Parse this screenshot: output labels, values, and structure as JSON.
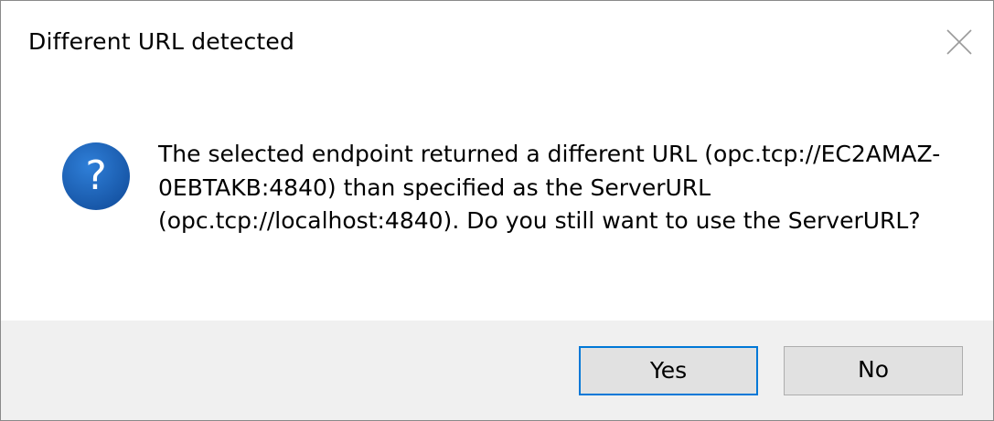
{
  "dialog": {
    "title": "Different URL detected",
    "message": "The selected endpoint returned a different URL (opc.tcp://EC2AMAZ-0EBTAKB:4840) than specified as the ServerURL (opc.tcp://localhost:4840). Do you still want to use the ServerURL?",
    "icon": "question-icon",
    "close_icon": "close-icon",
    "buttons": {
      "yes_label": "Yes",
      "no_label": "No"
    }
  },
  "colors": {
    "icon_blue": "#1c5fae",
    "focus_border": "#0078d7",
    "footer_bg": "#f0f0f0",
    "button_bg": "#e1e1e1"
  }
}
